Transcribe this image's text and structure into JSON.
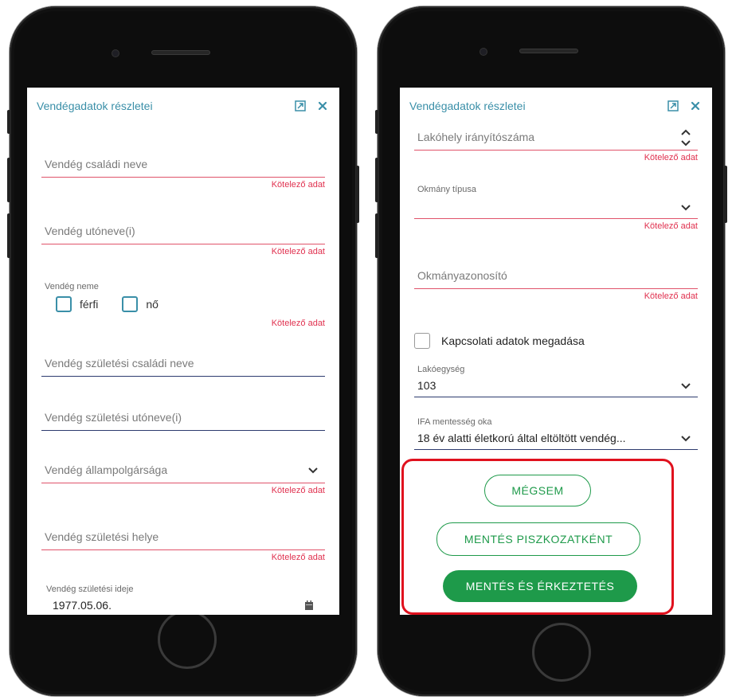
{
  "left_screen": {
    "header_title": "Vendégadatok részletei",
    "expand_icon": "expand-icon",
    "close_icon": "close-icon",
    "family_name_placeholder": "Vendég családi neve",
    "family_name_error": "Kötelező adat",
    "given_name_placeholder": "Vendég utóneve(i)",
    "given_name_error": "Kötelező adat",
    "gender_label": "Vendég neme",
    "gender_male": "férfi",
    "gender_female": "nő",
    "gender_error": "Kötelező adat",
    "birth_family_name_placeholder": "Vendég születési családi neve",
    "birth_given_name_placeholder": "Vendég születési utóneve(i)",
    "citizenship_placeholder": "Vendég állampolgársága",
    "citizenship_error": "Kötelező adat",
    "birth_place_placeholder": "Vendég születési helye",
    "birth_place_error": "Kötelező adat",
    "birth_date_label": "Vendég születési ideje",
    "birth_date_value": "1977.05.06."
  },
  "right_screen": {
    "header_title": "Vendégadatok részletei",
    "expand_icon": "expand-icon",
    "close_icon": "close-icon",
    "zip_placeholder": "Lakóhely irányítószáma",
    "zip_error": "Kötelező adat",
    "doc_type_label": "Okmány típusa",
    "doc_type_error": "Kötelező adat",
    "doc_id_placeholder": "Okmányazonosító",
    "doc_id_error": "Kötelező adat",
    "contact_checkbox_label": "Kapcsolati adatok megadása",
    "unit_label": "Lakóegység",
    "unit_value": "103",
    "ifa_label": "IFA mentesség oka",
    "ifa_value": "18 év alatti életkorú által eltöltött vendég...",
    "cancel_label": "MÉGSEM",
    "save_draft_label": "MENTÉS PISZKOZATKÉNT",
    "save_checkin_label": "MENTÉS ÉS ÉRKEZTETÉS"
  },
  "colors": {
    "accent": "#3a8fa8",
    "error": "#e0314f",
    "primary_green": "#1e9a4a",
    "highlight_red": "#e0111e"
  }
}
